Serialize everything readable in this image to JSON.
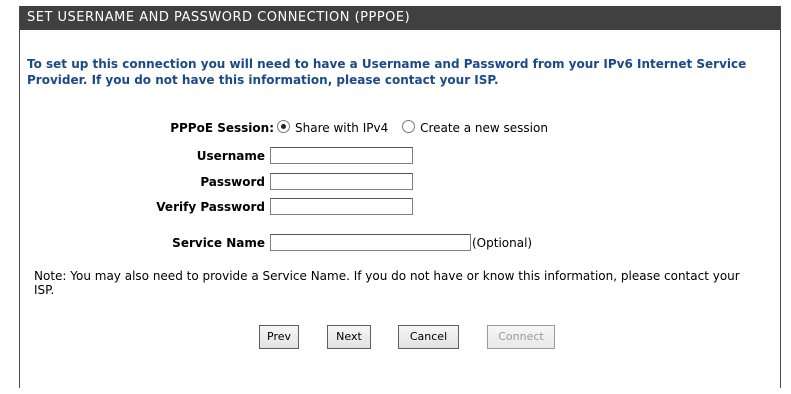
{
  "header": {
    "title": "SET USERNAME AND PASSWORD CONNECTION (PPPOE)"
  },
  "intro": {
    "text": "To set up this connection you will need to have a Username and Password from your IPv6 Internet Service Provider. If you do not have this information, please contact your ISP."
  },
  "form": {
    "session": {
      "label": "PPPoE Session:",
      "options": [
        {
          "label": "Share with IPv4",
          "selected": true
        },
        {
          "label": "Create a new session",
          "selected": false
        }
      ]
    },
    "username": {
      "label": "Username :",
      "value": ""
    },
    "password": {
      "label": "Password :",
      "value": ""
    },
    "verify_password": {
      "label": "Verify Password :",
      "value": ""
    },
    "service_name": {
      "label": "Service Name :",
      "value": "",
      "hint": "(Optional)"
    }
  },
  "note": {
    "text": "Note: You may also need to provide a Service Name. If you do not have or know this information, please contact your ISP."
  },
  "buttons": {
    "prev": "Prev",
    "next": "Next",
    "cancel": "Cancel",
    "connect": "Connect"
  },
  "colors": {
    "header_bg": "#404040",
    "intro_text": "#1a4a88"
  }
}
